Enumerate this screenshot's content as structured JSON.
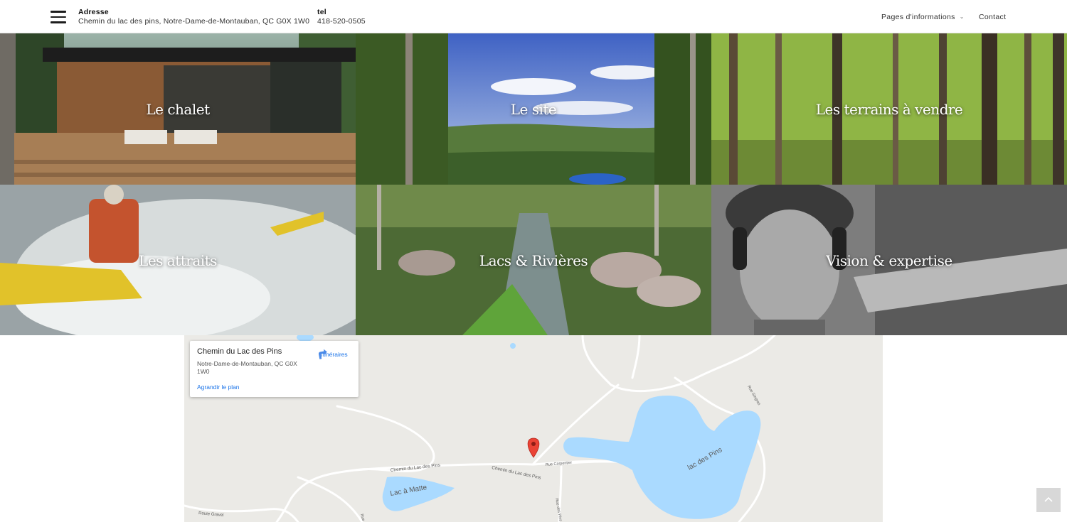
{
  "header": {
    "address_label": "Adresse",
    "address_value": "Chemin du lac des pins, Notre-Dame-de-Montauban, QC G0X 1W0",
    "tel_label": "tel",
    "tel_value": "418-520-0505",
    "nav_pages": "Pages d'informations",
    "nav_contact": "Contact",
    "menu_icon": "hamburger-icon",
    "chevron_icon": "chevron-down-icon"
  },
  "tiles": [
    {
      "label": "Le chalet"
    },
    {
      "label": "Le site"
    },
    {
      "label": "Les terrains à vendre"
    },
    {
      "label": "Les attraits"
    },
    {
      "label": "Lacs & Rivières"
    },
    {
      "label": "Vision & expertise"
    }
  ],
  "map": {
    "place_title": "Chemin du Lac des Pins",
    "place_address": "Notre-Dame-de-Montauban, QC G0X 1W0",
    "directions_label": "Itinéraires",
    "enlarge_label": "Agrandir le plan",
    "labels": {
      "road1": "Chemin du Lac des Pins",
      "road2": "Chemin du Lac des Pins",
      "road3": "Rue Carpentier",
      "road4": "Rue Gingras",
      "road5": "Route Gravel",
      "road6": "Rue des Pins",
      "road7": "Rue des Pins",
      "lake1": "Lac à Matte",
      "lake2": "lac des Pins"
    },
    "water_color": "#aadaff",
    "marker_color": "#ea4335"
  },
  "scroll_top_icon": "arrow-up-icon"
}
